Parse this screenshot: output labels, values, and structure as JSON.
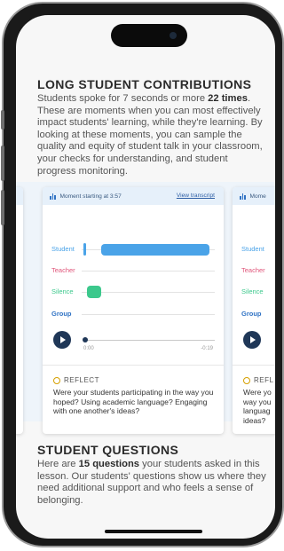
{
  "long_contributions": {
    "title": "LONG STUDENT CONTRIBUTIONS",
    "intro_prefix": "Students spoke for 7 seconds or more ",
    "intro_count": "22 times",
    "intro_suffix": ". These are moments when you can most effectively impact students' learning, while they're learning. By looking at these moments, you can sample the quality and equity of student talk in your classroom, your checks for understanding, and student progress monitoring."
  },
  "card_main": {
    "header": "Moment starting at 3:57",
    "transcript_link": "View transcript",
    "rows": [
      {
        "label": "Student",
        "color": "#4aa3e8"
      },
      {
        "label": "Teacher",
        "color": "#e0557a"
      },
      {
        "label": "Silence",
        "color": "#3cc88c"
      },
      {
        "label": "Group",
        "color": "#2f72c4"
      }
    ],
    "time_start": "0:00",
    "time_end": "-0:19",
    "reflect_label": "REFLECT",
    "reflect_text": "Were your students participating in the way you hoped? Using academic language? Engaging with one another's ideas?"
  },
  "card_right": {
    "header": "Mome",
    "rows": [
      "Student",
      "Teacher",
      "Silence",
      "Group"
    ],
    "reflect_label": "REFL",
    "reflect_lines": [
      "Were yo",
      "way you",
      "languag",
      "ideas?"
    ]
  },
  "student_questions": {
    "title": "STUDENT QUESTIONS",
    "intro_prefix": "Here are ",
    "intro_count": "15 questions",
    "intro_suffix": " your students asked in this lesson. Our students' questions show us where they need additional support and who feels a sense of belonging."
  }
}
